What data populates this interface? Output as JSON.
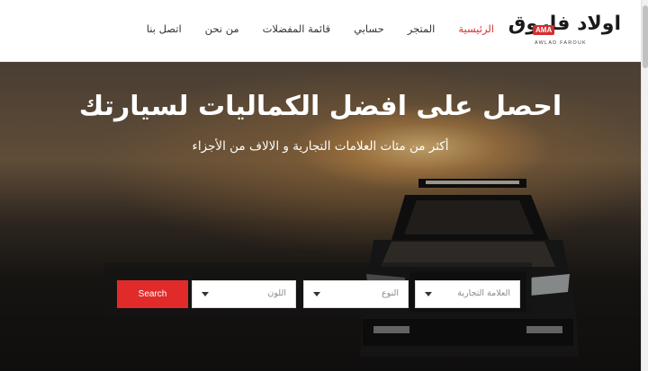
{
  "brand": {
    "logo_text_ar": "اولاد فاروق",
    "logo_badge": "AMA",
    "logo_text_en": "AWLAD FAROUK",
    "accent_color": "#d32f2f"
  },
  "nav": {
    "items": [
      {
        "label": "الرئيسية",
        "active": true
      },
      {
        "label": "المتجر",
        "active": false
      },
      {
        "label": "حسابي",
        "active": false
      },
      {
        "label": "قائمة المفضلات",
        "active": false
      },
      {
        "label": "من نحن",
        "active": false
      },
      {
        "label": "اتصل بنا",
        "active": false
      }
    ]
  },
  "hero": {
    "title": "احصل على افضل الكماليات لسيارتك",
    "subtitle": "أكثر من مئات العلامات التجارية و الالاف من الأجزاء"
  },
  "search": {
    "button_label": "Search",
    "button_color": "#e12b2b",
    "brand_select": "العلامة التجارية",
    "type_select": "النوع",
    "color_select": "اللون"
  }
}
